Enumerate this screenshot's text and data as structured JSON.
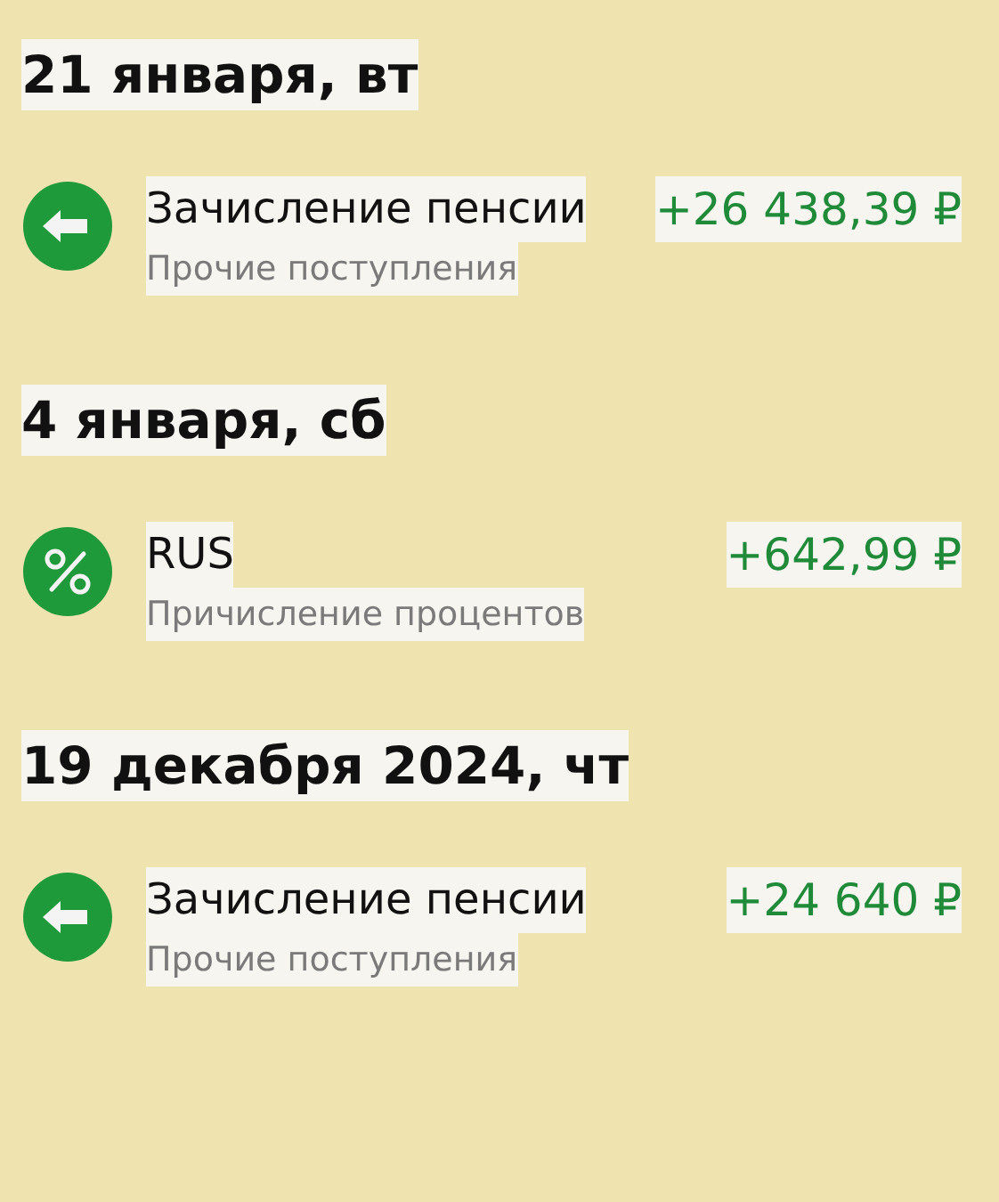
{
  "groups": [
    {
      "date": "21 января, вт",
      "transactions": [
        {
          "kind": "transfer",
          "title": "Зачисление пенсии",
          "category": "Прочие поступления",
          "amount": "+26 438,39 ₽"
        }
      ]
    },
    {
      "date": "4 января, сб",
      "transactions": [
        {
          "kind": "interest",
          "title": "RUS",
          "category": "Причисление процентов",
          "amount": "+642,99 ₽"
        }
      ]
    },
    {
      "date": "19 декабря 2024, чт",
      "transactions": [
        {
          "kind": "transfer",
          "title": "Зачисление пенсии",
          "category": "Прочие поступления",
          "amount": "+24 640 ₽"
        }
      ]
    }
  ]
}
